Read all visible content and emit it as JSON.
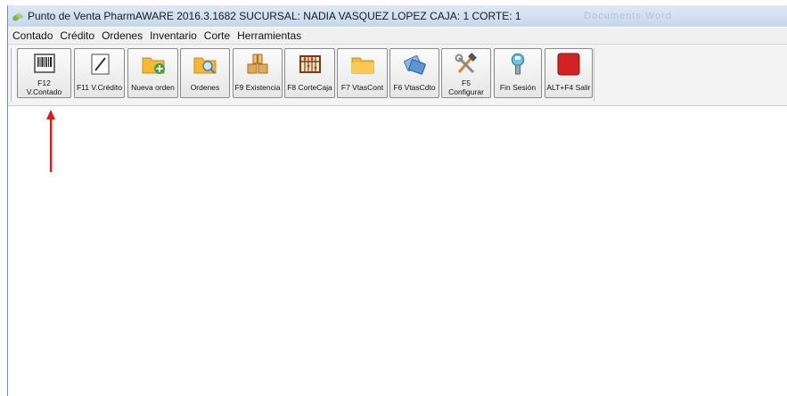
{
  "window": {
    "title": "Punto de Venta PharmAWARE 2016.3.1682 SUCURSAL: NADIA VASQUEZ LOPEZ CAJA: 1  CORTE: 1",
    "ghost_text": "Documents  Word"
  },
  "menu": [
    "Contado",
    "Crédito",
    "Ordenes",
    "Inventario",
    "Corte",
    "Herramientas"
  ],
  "toolbar": {
    "buttons": [
      {
        "label": "F12\nV.Contado",
        "icon": "barcode-icon"
      },
      {
        "label": "F11 V.Crédito",
        "icon": "pencil-icon"
      },
      {
        "label": "Nueva orden",
        "icon": "folder-add-icon"
      },
      {
        "label": "Ordenes",
        "icon": "folder-search-icon"
      },
      {
        "label": "F9 Existencia",
        "icon": "boxes-icon"
      },
      {
        "label": "F8 CorteCaja",
        "icon": "abacus-icon"
      },
      {
        "label": "F7 VtasCont",
        "icon": "folder-icon"
      },
      {
        "label": "F6 VtasCdto",
        "icon": "cards-icon"
      },
      {
        "label": "F5\nConfigurar",
        "icon": "tools-icon"
      },
      {
        "label": "Fin Sesión",
        "icon": "key-icon"
      },
      {
        "label": "ALT+F4 Salir",
        "icon": "stop-icon"
      }
    ]
  },
  "colors": {
    "annotation_arrow": "#e8141b",
    "titlebar": "#c6d7ec"
  }
}
